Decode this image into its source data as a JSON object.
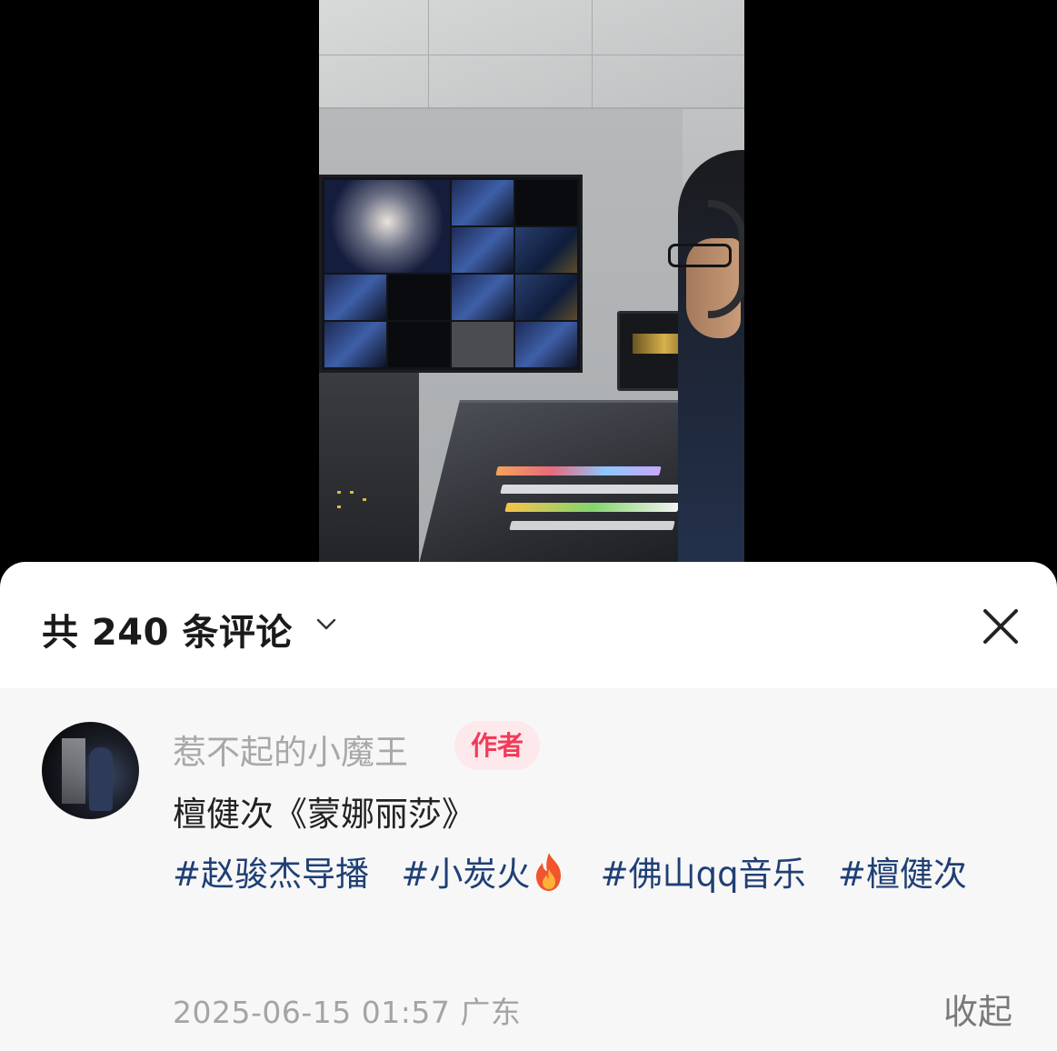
{
  "comments_panel": {
    "title": "共 240 条评论",
    "count": 240
  },
  "comment": {
    "username": "惹不起的小魔王",
    "author_badge": "作者",
    "text": "檀健次《蒙娜丽莎》",
    "hashtags": [
      "#赵骏杰导播",
      "#小炭火",
      "#佛山qq音乐",
      "#檀健次"
    ],
    "fire_emoji": "🔥",
    "timestamp": "2025-06-15 01:57",
    "location": "广东",
    "collapse_label": "收起"
  },
  "icons": {
    "chevron": "chevron-down-icon",
    "close": "close-icon",
    "fire": "fire-icon"
  },
  "colors": {
    "badge_text": "#f23b57",
    "badge_bg": "#fde8eb",
    "hashtag": "#1f3f75",
    "comment_bg": "#f7f7f7"
  }
}
